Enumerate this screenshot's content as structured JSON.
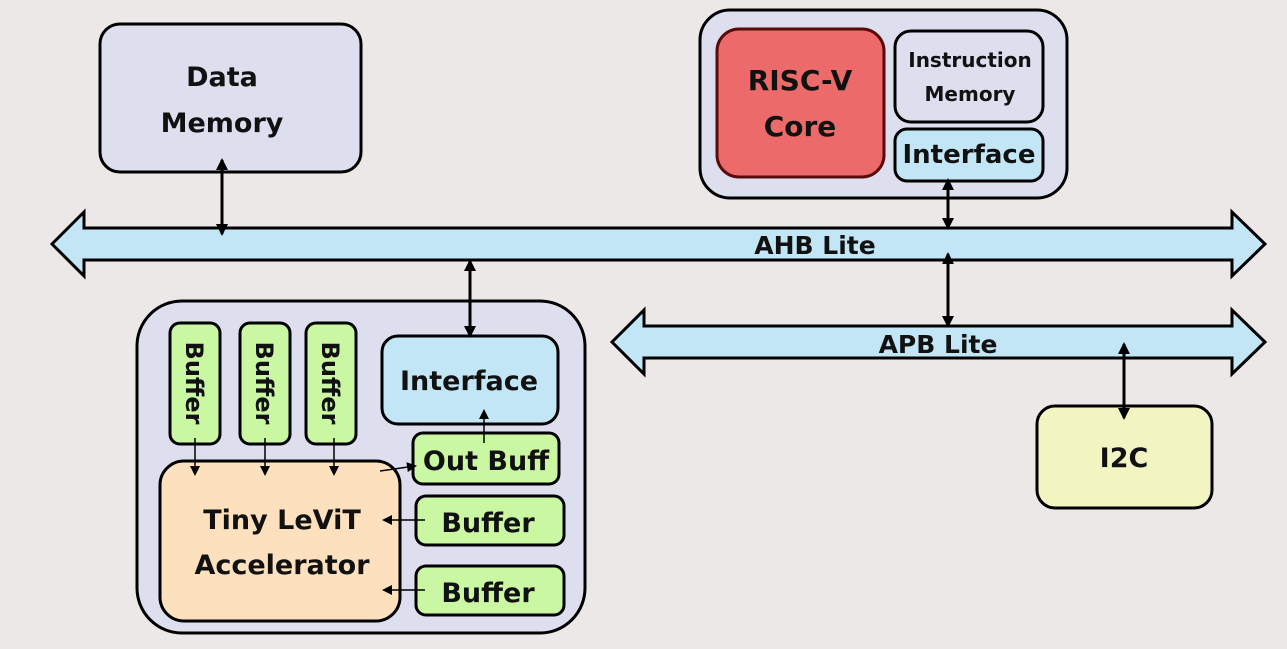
{
  "diagram": {
    "colors": {
      "background": "#ede8e8",
      "container": "#dddfee",
      "risc_core": "#ec6a6a",
      "interface": "#c2e6f6",
      "buffer": "#caf7a2",
      "accelerator": "#fde0bd",
      "i2c": "#f2f4c2",
      "bus": "#c2e6f6"
    },
    "data_memory": {
      "line1": "Data",
      "line2": "Memory"
    },
    "cpu_subsystem": {
      "core": {
        "line1": "RISC-V",
        "line2": "Core"
      },
      "instruction_memory": {
        "line1": "Instruction",
        "line2": "Memory"
      },
      "interface": "Interface"
    },
    "ahb_bus": "AHB Lite",
    "apb_bus": "APB Lite",
    "i2c": "I2C",
    "accelerator_subsystem": {
      "interface": "Interface",
      "input_buffers": [
        "Buffer",
        "Buffer",
        "Buffer"
      ],
      "out_buffer": "Out Buff",
      "side_buffers": [
        "Buffer",
        "Buffer"
      ],
      "accelerator": {
        "line1": "Tiny LeViT",
        "line2": "Accelerator"
      }
    }
  }
}
